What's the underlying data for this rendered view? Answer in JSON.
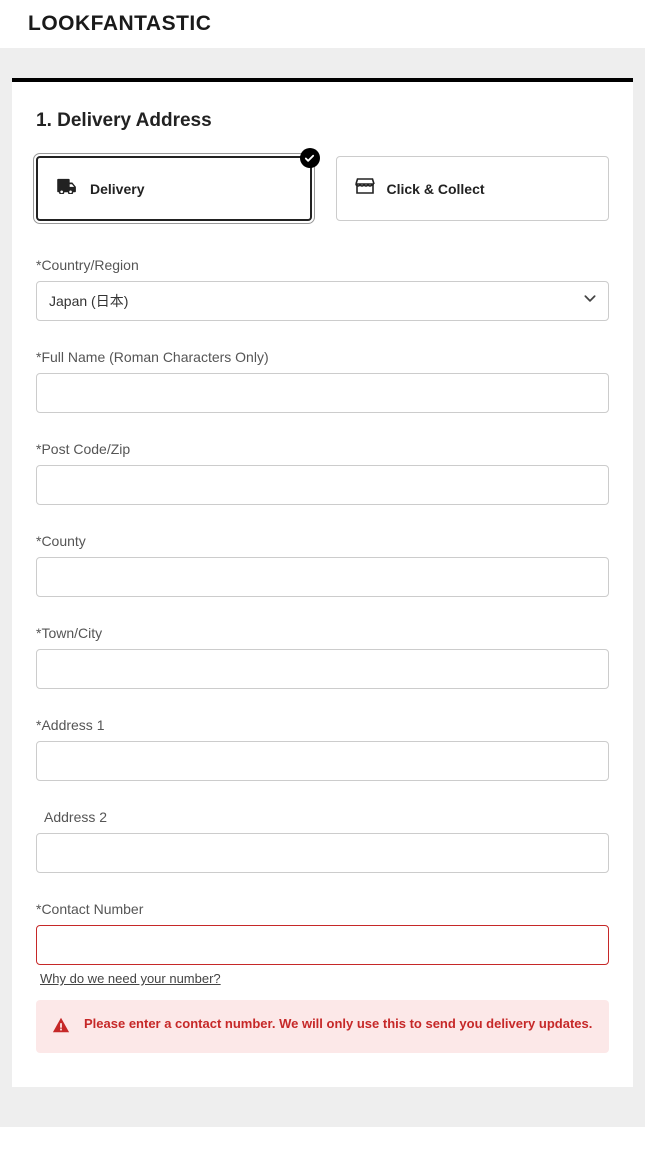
{
  "brand": "LOOKFANTASTIC",
  "section": {
    "title": "1. Delivery Address"
  },
  "options": {
    "delivery": "Delivery",
    "click_collect": "Click & Collect"
  },
  "fields": {
    "country": {
      "label": "*Country/Region",
      "value": "Japan (日本)"
    },
    "full_name": {
      "label": "*Full Name (Roman Characters Only)",
      "value": ""
    },
    "postcode": {
      "label": "*Post Code/Zip",
      "value": ""
    },
    "county": {
      "label": "*County",
      "value": ""
    },
    "city": {
      "label": "*Town/City",
      "value": ""
    },
    "address1": {
      "label": "*Address 1",
      "value": ""
    },
    "address2": {
      "label": "Address 2",
      "value": ""
    },
    "contact": {
      "label": "*Contact Number",
      "value": "",
      "help": "Why do we need your number?"
    }
  },
  "error": {
    "message": "Please enter a contact number. We will only use this to send you delivery updates."
  }
}
